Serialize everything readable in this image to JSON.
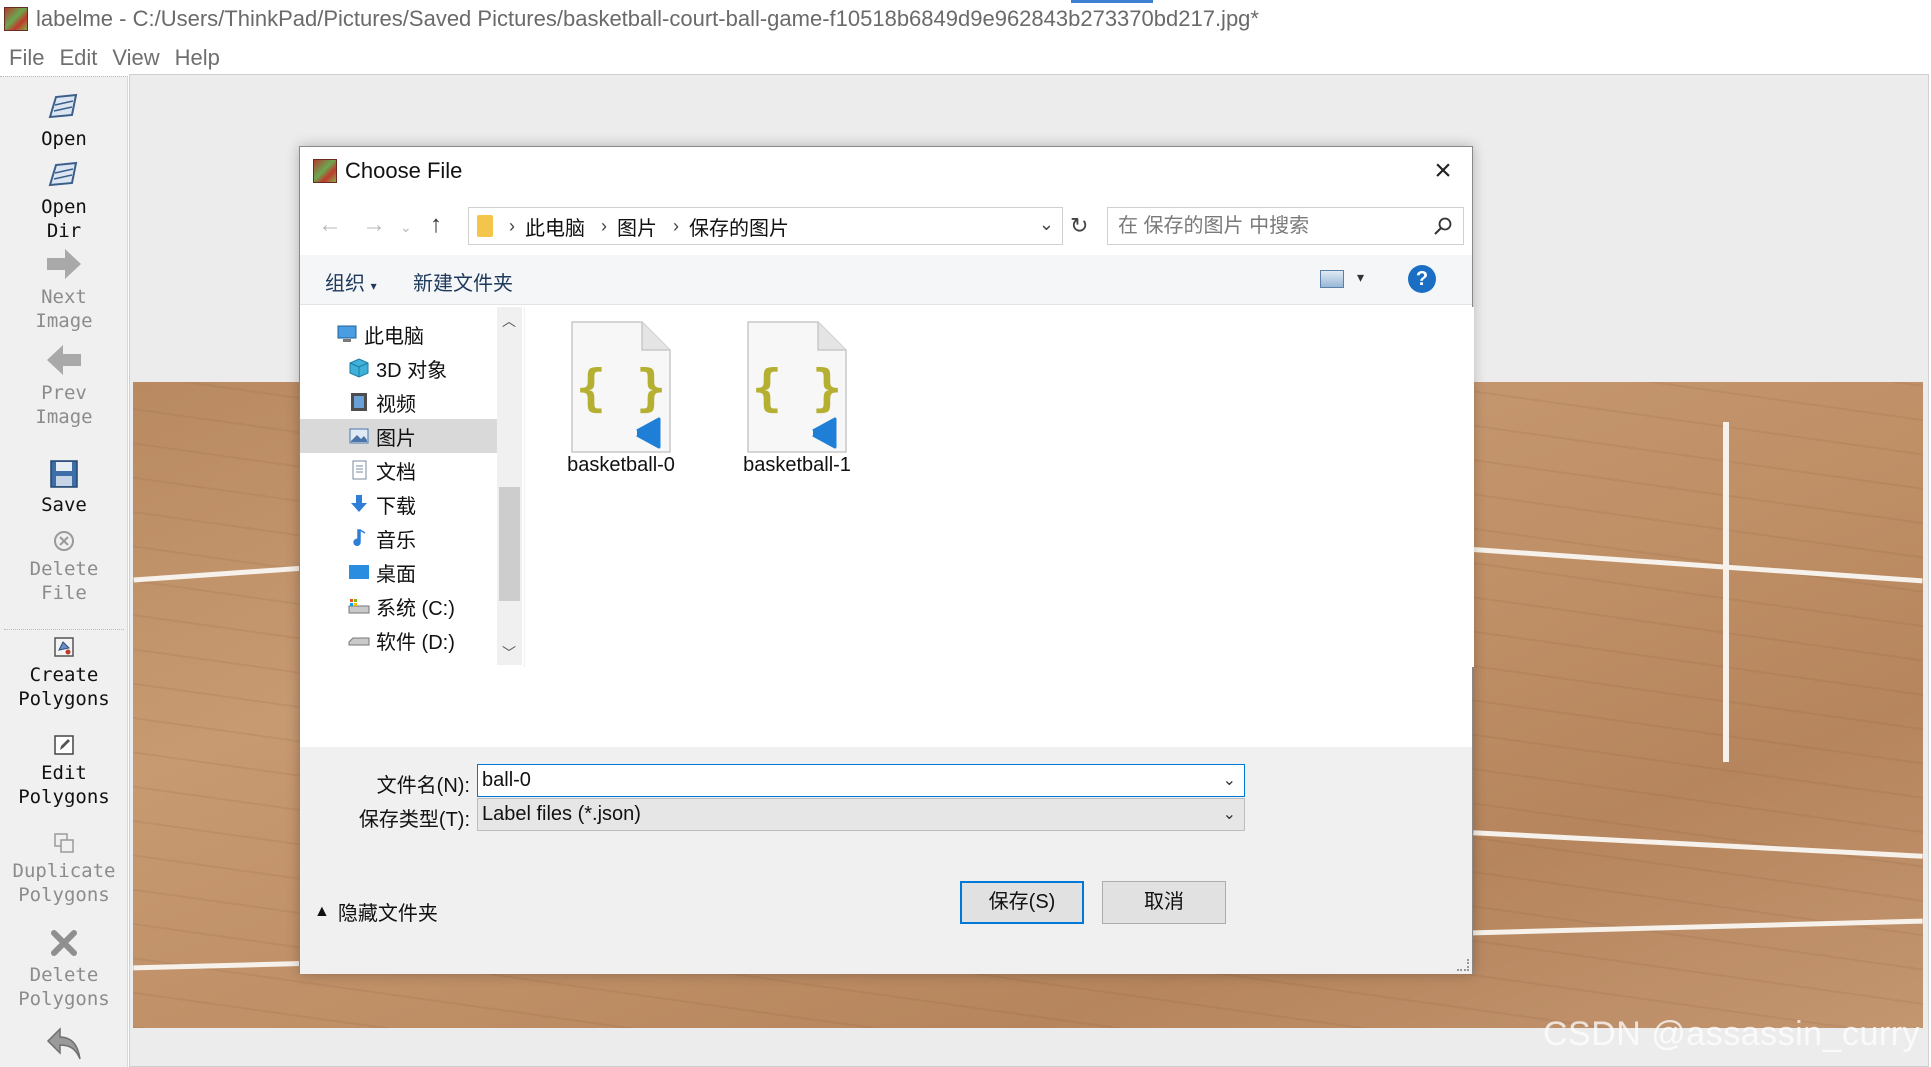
{
  "window": {
    "title": "labelme - C:/Users/ThinkPad/Pictures/Saved Pictures/basketball-court-ball-game-f10518b6849d9e962843b273370bd217.jpg*"
  },
  "menu": {
    "file": "File",
    "edit": "Edit",
    "view": "View",
    "help": "Help"
  },
  "toolbar": {
    "open": "Open",
    "open_dir": "Open\nDir",
    "next_image": "Next\nImage",
    "prev_image": "Prev\nImage",
    "save": "Save",
    "delete_file": "Delete\nFile",
    "create_polygons": "Create\nPolygons",
    "edit_polygons": "Edit\nPolygons",
    "duplicate_polygons": "Duplicate\nPolygons",
    "delete_polygons": "Delete\nPolygons"
  },
  "dialog": {
    "title": "Choose File",
    "breadcrumb": [
      "此电脑",
      "图片",
      "保存的图片"
    ],
    "search_placeholder": "在 保存的图片 中搜索",
    "organize": "组织",
    "new_folder": "新建文件夹",
    "help_glyph": "?",
    "nav_items": [
      {
        "label": "此电脑",
        "icon": "computer-icon"
      },
      {
        "label": "3D 对象",
        "icon": "3d-objects-icon"
      },
      {
        "label": "视频",
        "icon": "video-icon"
      },
      {
        "label": "图片",
        "icon": "pictures-icon"
      },
      {
        "label": "文档",
        "icon": "documents-icon"
      },
      {
        "label": "下载",
        "icon": "download-icon"
      },
      {
        "label": "音乐",
        "icon": "music-icon"
      },
      {
        "label": "桌面",
        "icon": "desktop-icon"
      },
      {
        "label": "系统 (C:)",
        "icon": "drive-c-icon"
      },
      {
        "label": "软件 (D:)",
        "icon": "drive-d-icon"
      }
    ],
    "selected_nav": "图片",
    "files": [
      {
        "name": "basketball-0",
        "icon": "json-file-icon"
      },
      {
        "name": "basketball-1",
        "icon": "json-file-icon"
      }
    ],
    "filename_label": "文件名(N):",
    "filename_value": "ball-0",
    "filetype_label": "保存类型(T):",
    "filetype_value": "Label files (*.json)",
    "hide_folders": "隐藏文件夹",
    "save_button": "保存(S)",
    "cancel_button": "取消"
  },
  "watermark": "CSDN @assassin_curry",
  "colors": {
    "accent": "#0078d7",
    "json_brace": "#b5b032",
    "vscode_blue": "#1f7fd6",
    "help_blue": "#1a6fc4"
  }
}
